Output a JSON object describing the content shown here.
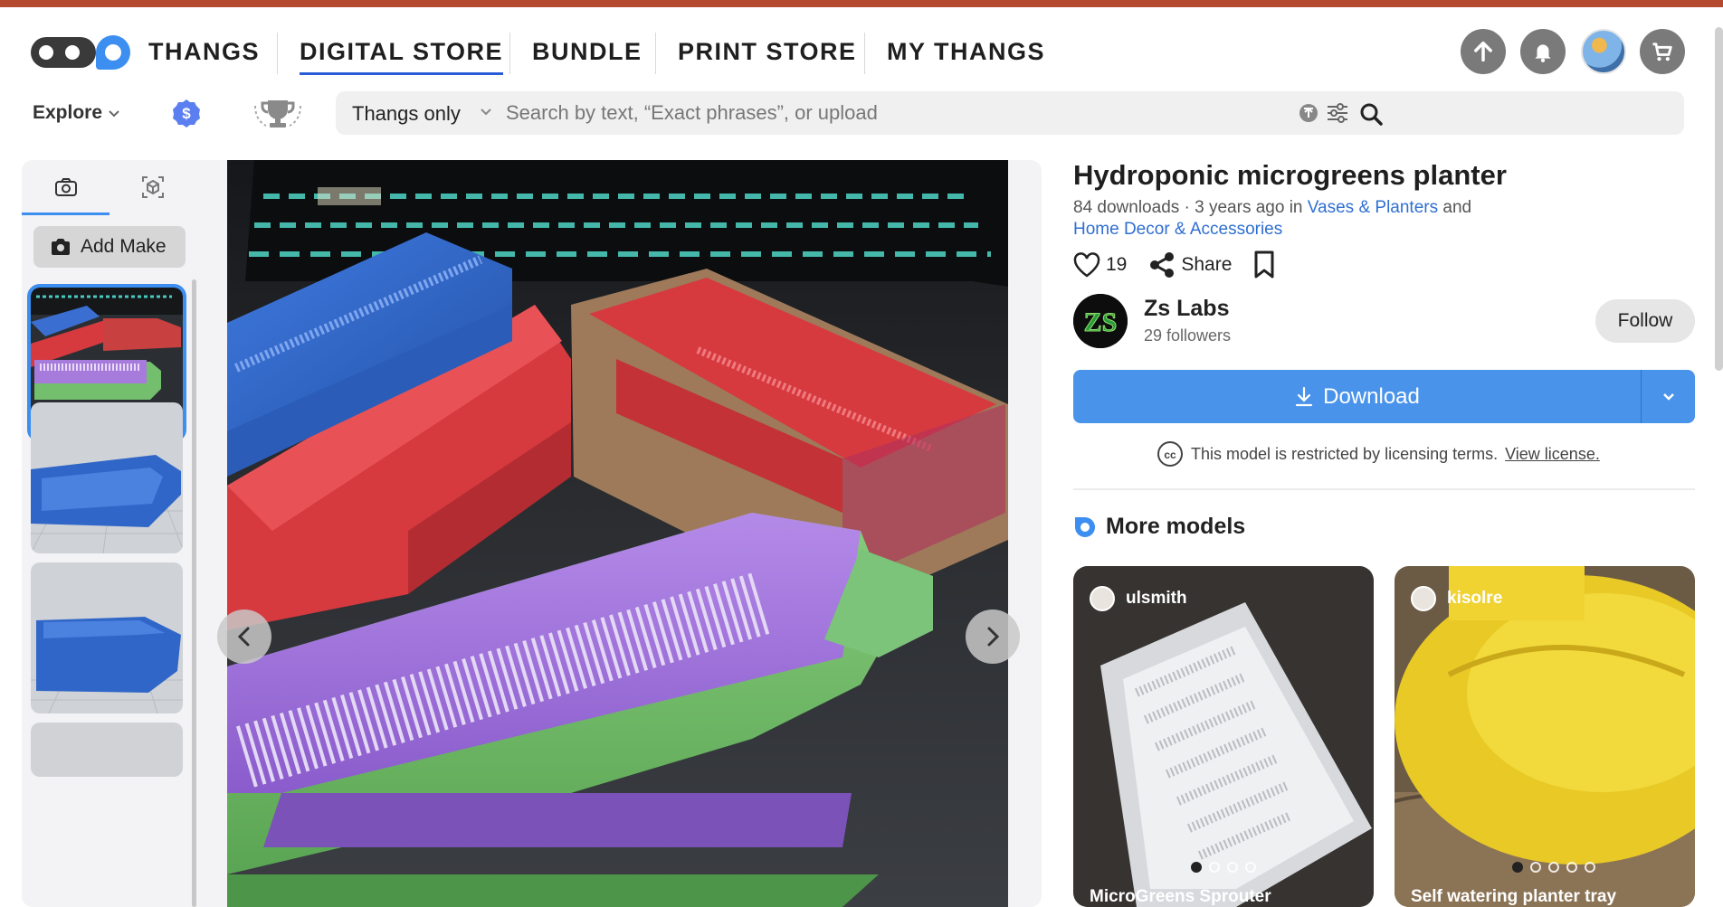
{
  "nav": {
    "brand": "THANGS",
    "links": [
      "DIGITAL STORE",
      "BUNDLE",
      "PRINT STORE",
      "MY THANGS"
    ],
    "active": "DIGITAL STORE",
    "icons": [
      "upload-icon",
      "bell-icon",
      "avatar",
      "cart-icon"
    ]
  },
  "toolbar": {
    "explore_label": "Explore",
    "search_scope": "Thangs only",
    "search_placeholder": "Search by text, “Exact phrases”, or upload"
  },
  "gallery": {
    "tabs": [
      "camera-icon",
      "model-3d-icon"
    ],
    "add_make_label": "Add Make",
    "thumbnails": [
      "thumb-photo-planter-set",
      "thumb-render-blue-tray",
      "thumb-render-blue-box"
    ]
  },
  "model": {
    "title": "Hydroponic microgreens planter",
    "meta_prefix": "84 downloads · 3 years ago in ",
    "category_1": "Vases & Planters",
    "meta_and": " and",
    "category_2": "Home Decor & Accessories",
    "likes": "19",
    "share_label": "Share",
    "download_label": "Download",
    "license_text": "This model is restricted by licensing terms.",
    "license_link": "View license."
  },
  "creator": {
    "name": "Zs Labs",
    "followers": "29 followers",
    "follow_label": "Follow",
    "avatar_letters": "ZS"
  },
  "more_models": {
    "heading": "More models",
    "cards": [
      {
        "user": "ulsmith",
        "title": "MicroGreens Sprouter"
      },
      {
        "user": "kisolre",
        "title": "Self watering planter tray"
      }
    ]
  },
  "colors": {
    "accent": "#3c8ef0",
    "download": "#4a93ea",
    "link": "#2f6fd1",
    "top_bar": "#b5492f"
  }
}
